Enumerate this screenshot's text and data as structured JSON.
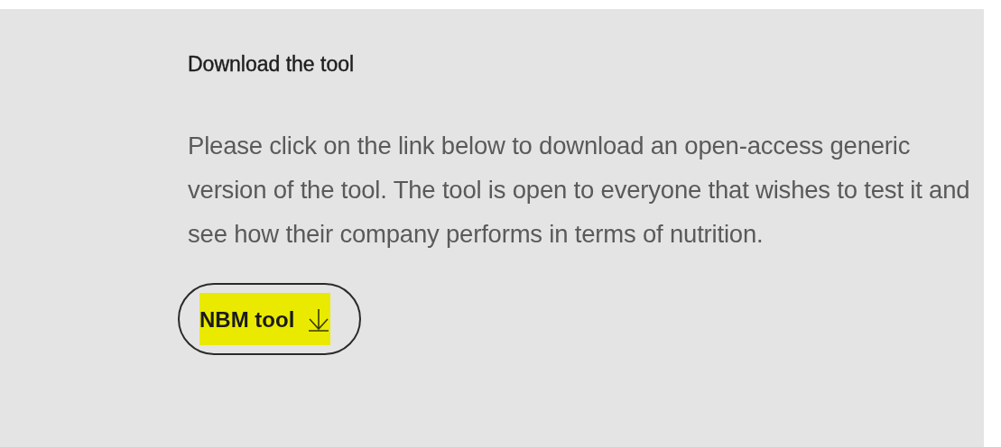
{
  "heading": "Download the tool",
  "body": "Please click on the link below to download an open-access generic version of the tool. The tool is open to everyone that wishes to test it and see how their company performs in terms of nutrition.",
  "button": {
    "label": "NBM tool",
    "highlighted": true
  }
}
